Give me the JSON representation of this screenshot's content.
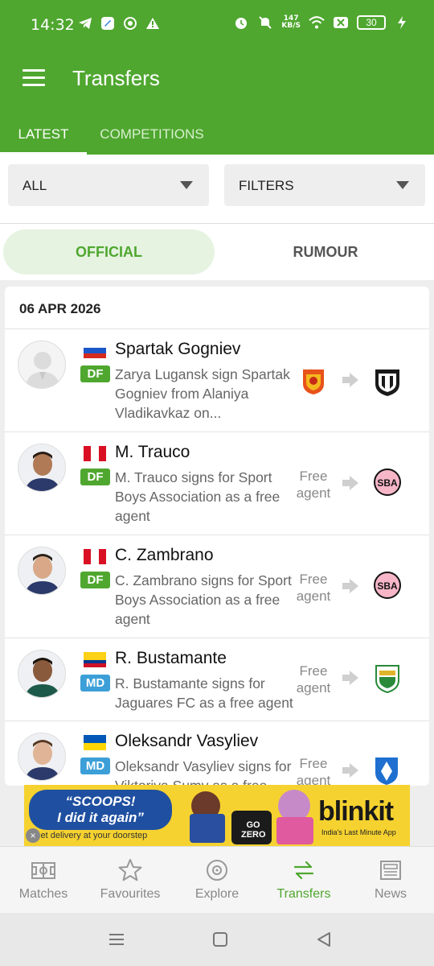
{
  "status_bar": {
    "time": "14:32",
    "net_speed_value": "147",
    "net_speed_unit": "KB/S",
    "battery": "30"
  },
  "app": {
    "title": "Transfers",
    "tabs": [
      {
        "label": "LATEST",
        "active": true
      },
      {
        "label": "COMPETITIONS",
        "active": false
      }
    ]
  },
  "filters": {
    "scope": "ALL",
    "filters_label": "FILTERS"
  },
  "segment": {
    "official": "OFFICIAL",
    "rumour": "RUMOUR",
    "selected": "OFFICIAL"
  },
  "list": {
    "date": "06 APR 2026",
    "items": [
      {
        "player": "Spartak Gogniev",
        "flag": "russia",
        "position": "DF",
        "description": "Zarya Lugansk sign Spartak Gogniev from Alaniya Vladikavkaz on...",
        "from": "",
        "from_icon": "zarya-lugansk-crest-icon",
        "to_icon": "alaniya-vladikavkaz-crest-icon"
      },
      {
        "player": "M. Trauco",
        "flag": "peru",
        "position": "DF",
        "description": "M. Trauco signs for Sport Boys Association as a free agent",
        "from": "Free agent",
        "to_icon": "sport-boys-crest-icon"
      },
      {
        "player": "C. Zambrano",
        "flag": "peru",
        "position": "DF",
        "description": "C. Zambrano signs for Sport Boys Association as a free agent",
        "from": "Free agent",
        "to_icon": "sport-boys-crest-icon"
      },
      {
        "player": "R. Bustamante",
        "flag": "colombia",
        "position": "MD",
        "description": "R. Bustamante signs for Jaguares FC as a free agent",
        "from": "Free agent",
        "to_icon": "jaguares-fc-crest-icon"
      },
      {
        "player": "Oleksandr Vasyliev",
        "flag": "ukraine",
        "position": "MD",
        "description": "Oleksandr Vasyliev signs for Viktoriya Sumy as a free agent",
        "from": "Free agent",
        "to_icon": "viktoriya-sumy-crest-icon"
      }
    ]
  },
  "ad": {
    "headline_1": "“SCOOPS!",
    "headline_2": "I did it again”",
    "subline": "Get delivery at your doorstep",
    "product_text": "GO ZERO",
    "brand": "blinkit",
    "brand_tagline": "India's Last Minute App"
  },
  "bottom_nav": [
    {
      "label": "Matches",
      "icon": "pitch-icon",
      "active": false
    },
    {
      "label": "Favourites",
      "icon": "star-icon",
      "active": false
    },
    {
      "label": "Explore",
      "icon": "compass-icon",
      "active": false
    },
    {
      "label": "Transfers",
      "icon": "transfer-arrows-icon",
      "active": true
    },
    {
      "label": "News",
      "icon": "newspaper-icon",
      "active": false
    }
  ],
  "colors": {
    "brand_green": "#4fa72f",
    "df_badge": "#4fa72f",
    "md_badge": "#3c9fd8"
  }
}
